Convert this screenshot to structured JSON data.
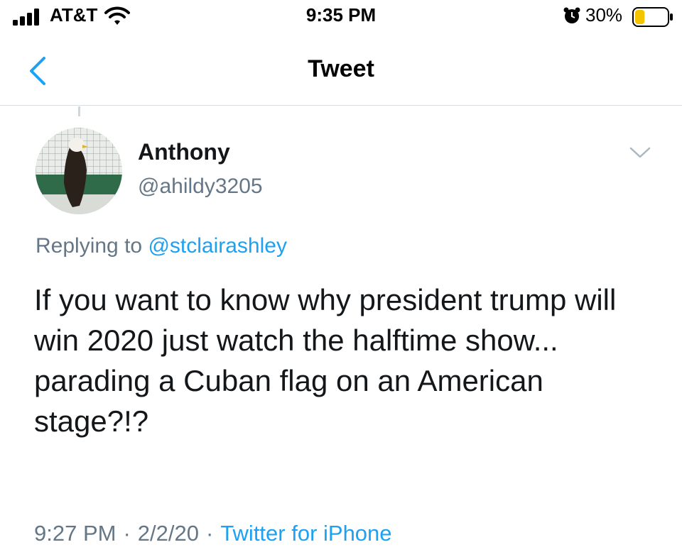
{
  "status_bar": {
    "carrier": "AT&T",
    "time": "9:35 PM",
    "battery_percent": "30%",
    "battery_level": 0.3
  },
  "nav": {
    "title": "Tweet"
  },
  "tweet": {
    "display_name": "Anthony",
    "handle": "@ahildy3205",
    "replying_prefix": "Replying to",
    "replying_handle": "@stclairashley",
    "text": "If you want to know why president trump will win 2020 just watch the halftime show... parading a Cuban flag on an American stage?!?",
    "time": "9:27 PM",
    "separator": "·",
    "date": "2/2/20",
    "source": "Twitter for iPhone"
  },
  "colors": {
    "accent": "#1da1f2",
    "secondary_text": "#657786",
    "primary_text": "#14171a",
    "battery_low": "#f5c400"
  }
}
